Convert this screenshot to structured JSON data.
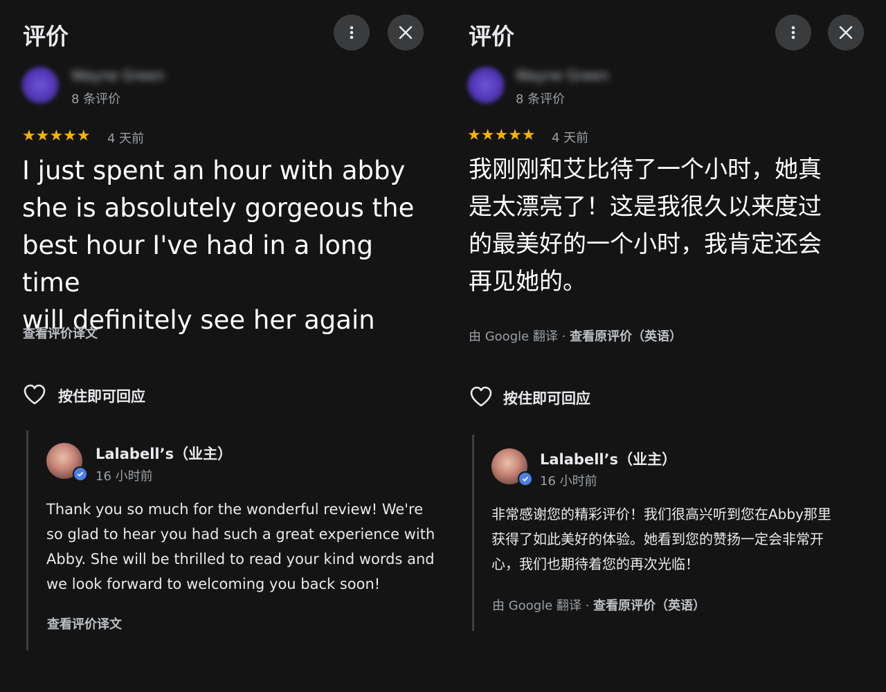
{
  "left": {
    "title": "评价",
    "reviewer": {
      "name": "Wayne Green",
      "review_count": "8 条评价"
    },
    "rating": {
      "stars": "★★★★★",
      "value": 5,
      "max": 5,
      "time": "4 天前"
    },
    "review_lines": [
      "I just spent an hour with abby",
      "she is absolutely gorgeous the",
      "best hour I've had in a long time",
      "will definitely see her again"
    ],
    "translate_link": "查看评价译文",
    "respond_label": "按住即可回应",
    "owner": {
      "name": "Lalabell’s（业主）",
      "time": "16 小时前",
      "reply_lines": [
        "Thank you so much for the wonderful review! We're",
        "so glad to hear you had such a great experience with",
        "Abby. She will be thrilled to read your kind words and",
        "we look forward to welcoming you back soon!"
      ],
      "translate_link": "查看评价译文"
    }
  },
  "right": {
    "title": "评价",
    "reviewer": {
      "name": "Wayne Green",
      "review_count": "8 条评价"
    },
    "rating": {
      "stars": "★★★★★",
      "value": 5,
      "max": 5,
      "time": "4 天前"
    },
    "review_lines": [
      "我刚刚和艾比待了一个小时，她真",
      "是太漂亮了！这是我很久以来度过",
      "的最美好的一个小时，我肯定还会",
      "再见她的。"
    ],
    "translation_note": {
      "prefix": "由 Google 翻译 · ",
      "link": "查看原评价（英语）"
    },
    "respond_label": "按住即可回应",
    "owner": {
      "name": "Lalabell’s（业主）",
      "time": "16 小时前",
      "reply_lines": [
        "非常感谢您的精彩评价！我们很高兴听到您在Abby那里",
        "获得了如此美好的体验。她看到您的赞扬一定会非常开",
        "心，我们也期待着您的再次光临！"
      ],
      "translation_note": {
        "prefix": "由 Google 翻译 · ",
        "link": "查看原评价（英语）"
      }
    }
  },
  "icons": {
    "more": "more-vert-icon",
    "close": "close-icon",
    "heart": "heart-outline-icon",
    "verified": "verified-check-icon"
  },
  "colors": {
    "background": "#141414",
    "star": "#f6b400",
    "button_bg": "#3a3b3d",
    "verified": "#4d7fe8",
    "avatar": "#5a3fc7"
  }
}
